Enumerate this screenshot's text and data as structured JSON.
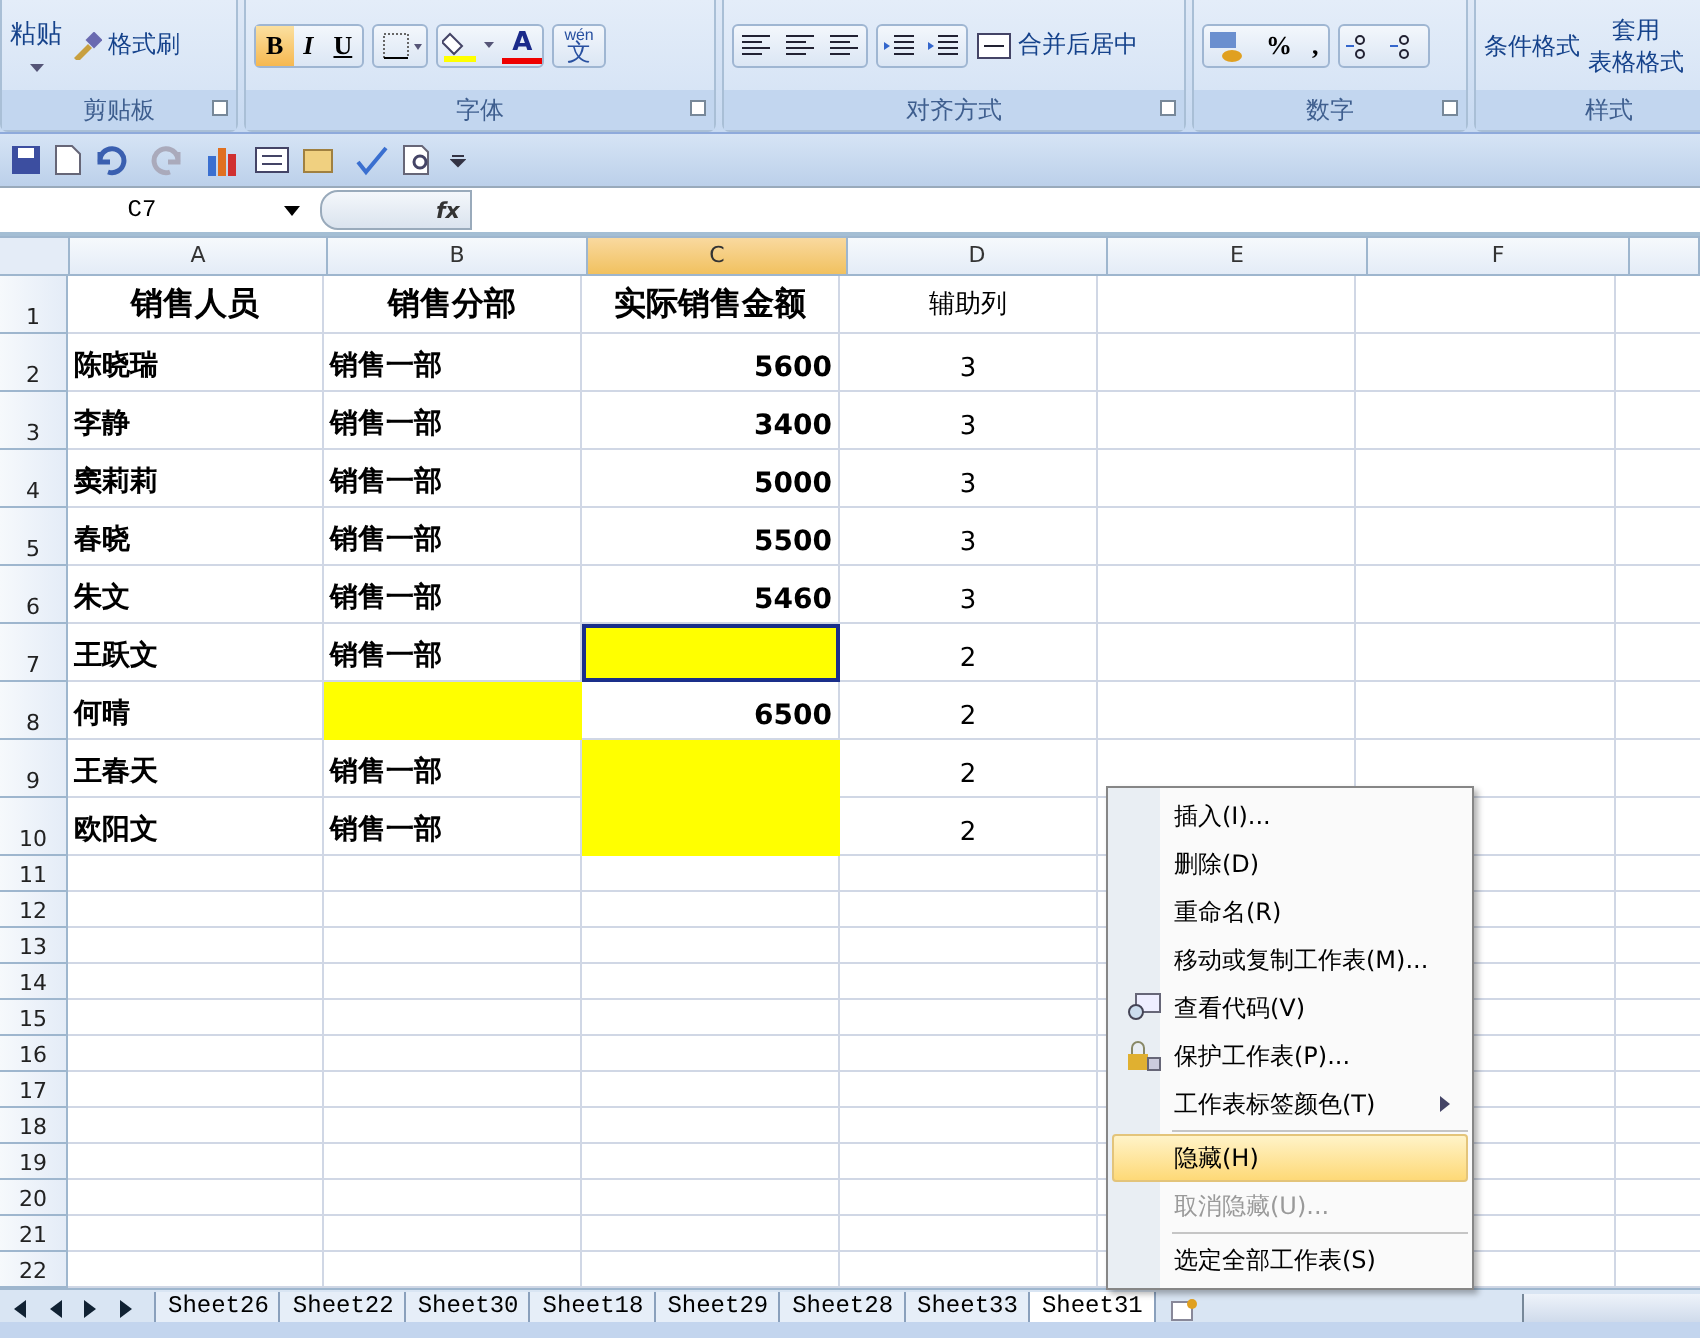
{
  "ribbon": {
    "groups": [
      {
        "label": "剪贴板",
        "kind": "clipboard",
        "paste": "粘贴",
        "format_painter": "格式刷"
      },
      {
        "label": "字体",
        "kind": "font",
        "buttons": [
          {
            "text": "B",
            "selected": true
          },
          {
            "text": "I",
            "selected": false
          },
          {
            "text": "U",
            "selected": false
          }
        ],
        "font_color": "A",
        "phonetic_top": "wén",
        "phonetic_main": "文"
      },
      {
        "label": "对齐方式",
        "kind": "align",
        "merge": "合并后居中"
      },
      {
        "label": "数字",
        "kind": "number",
        "percent": "%",
        "comma": ","
      },
      {
        "label": "样式",
        "kind": "styles",
        "conditional": "条件格式",
        "table_top": "套用",
        "table_bottom": "表格格式"
      }
    ]
  },
  "name_box": "C7",
  "fx": "fx",
  "columns": [
    {
      "label": "A",
      "selected": false
    },
    {
      "label": "B",
      "selected": false
    },
    {
      "label": "C",
      "selected": true
    },
    {
      "label": "D",
      "selected": false
    },
    {
      "label": "E",
      "selected": false
    },
    {
      "label": "F",
      "selected": false
    }
  ],
  "rows": [
    {
      "num": "1",
      "header": true,
      "cells": [
        {
          "text": "销售人员",
          "highlighted": false
        },
        {
          "text": "销售分部",
          "highlighted": false
        },
        {
          "text": "实际销售金额",
          "highlighted": false
        },
        {
          "text": "辅助列",
          "highlighted": false
        }
      ]
    },
    {
      "num": "2",
      "header": false,
      "cells": [
        {
          "text": "陈晓瑞",
          "highlighted": false
        },
        {
          "text": "销售一部",
          "highlighted": false
        },
        {
          "text": "5600",
          "highlighted": false
        },
        {
          "text": "3",
          "highlighted": false
        }
      ]
    },
    {
      "num": "3",
      "header": false,
      "cells": [
        {
          "text": "李静",
          "highlighted": false
        },
        {
          "text": "销售一部",
          "highlighted": false
        },
        {
          "text": "3400",
          "highlighted": false
        },
        {
          "text": "3",
          "highlighted": false
        }
      ]
    },
    {
      "num": "4",
      "header": false,
      "cells": [
        {
          "text": "窦莉莉",
          "highlighted": false
        },
        {
          "text": "销售一部",
          "highlighted": false
        },
        {
          "text": "5000",
          "highlighted": false
        },
        {
          "text": "3",
          "highlighted": false
        }
      ]
    },
    {
      "num": "5",
      "header": false,
      "cells": [
        {
          "text": "春晓",
          "highlighted": false
        },
        {
          "text": "销售一部",
          "highlighted": false
        },
        {
          "text": "5500",
          "highlighted": false
        },
        {
          "text": "3",
          "highlighted": false
        }
      ]
    },
    {
      "num": "6",
      "header": false,
      "cells": [
        {
          "text": "朱文",
          "highlighted": false
        },
        {
          "text": "销售一部",
          "highlighted": false
        },
        {
          "text": "5460",
          "highlighted": false
        },
        {
          "text": "3",
          "highlighted": false
        }
      ]
    },
    {
      "num": "7",
      "header": false,
      "cells": [
        {
          "text": "王跃文",
          "highlighted": false
        },
        {
          "text": "销售一部",
          "highlighted": false
        },
        {
          "text": "",
          "highlighted": true,
          "selected": true
        },
        {
          "text": "2",
          "highlighted": false
        }
      ]
    },
    {
      "num": "8",
      "header": false,
      "cells": [
        {
          "text": "何晴",
          "highlighted": false
        },
        {
          "text": "",
          "highlighted": true
        },
        {
          "text": "6500",
          "highlighted": false
        },
        {
          "text": "2",
          "highlighted": false
        }
      ]
    },
    {
      "num": "9",
      "header": false,
      "cells": [
        {
          "text": "王春天",
          "highlighted": false
        },
        {
          "text": "销售一部",
          "highlighted": false
        },
        {
          "text": "",
          "highlighted": true
        },
        {
          "text": "2",
          "highlighted": false
        }
      ]
    },
    {
      "num": "10",
      "header": false,
      "cells": [
        {
          "text": "欧阳文",
          "highlighted": false
        },
        {
          "text": "销售一部",
          "highlighted": false
        },
        {
          "text": "",
          "highlighted": true
        },
        {
          "text": "2",
          "highlighted": false
        }
      ]
    }
  ],
  "empty_rows": [
    "11",
    "12",
    "13",
    "14",
    "15",
    "16",
    "17",
    "18",
    "19",
    "20",
    "21",
    "22"
  ],
  "context_menu": [
    {
      "label": "插入(I)...",
      "kind": "plain",
      "selected": false,
      "disabled": false
    },
    {
      "label": "删除(D)",
      "kind": "plain",
      "selected": false,
      "disabled": false
    },
    {
      "label": "重命名(R)",
      "kind": "plain",
      "selected": false,
      "disabled": false
    },
    {
      "label": "移动或复制工作表(M)...",
      "kind": "plain",
      "selected": false,
      "disabled": false
    },
    {
      "label": "查看代码(V)",
      "kind": "code",
      "selected": false,
      "disabled": false
    },
    {
      "label": "保护工作表(P)...",
      "kind": "lock",
      "selected": false,
      "disabled": false
    },
    {
      "label": "工作表标签颜色(T)",
      "kind": "submenu",
      "selected": false,
      "disabled": false
    },
    {
      "label": "隐藏(H)",
      "kind": "plain",
      "selected": true,
      "disabled": false,
      "separator_before": true
    },
    {
      "label": "取消隐藏(U)...",
      "kind": "plain",
      "selected": false,
      "disabled": true
    },
    {
      "label": "选定全部工作表(S)",
      "kind": "plain",
      "selected": false,
      "disabled": false,
      "separator_before": true
    }
  ],
  "sheet_tabs": [
    {
      "label": "Sheet26",
      "selected": false
    },
    {
      "label": "Sheet22",
      "selected": false
    },
    {
      "label": "Sheet30",
      "selected": false
    },
    {
      "label": "Sheet18",
      "selected": false
    },
    {
      "label": "Sheet29",
      "selected": false
    },
    {
      "label": "Sheet28",
      "selected": false
    },
    {
      "label": "Sheet33",
      "selected": false
    },
    {
      "label": "Sheet31",
      "selected": true
    }
  ]
}
